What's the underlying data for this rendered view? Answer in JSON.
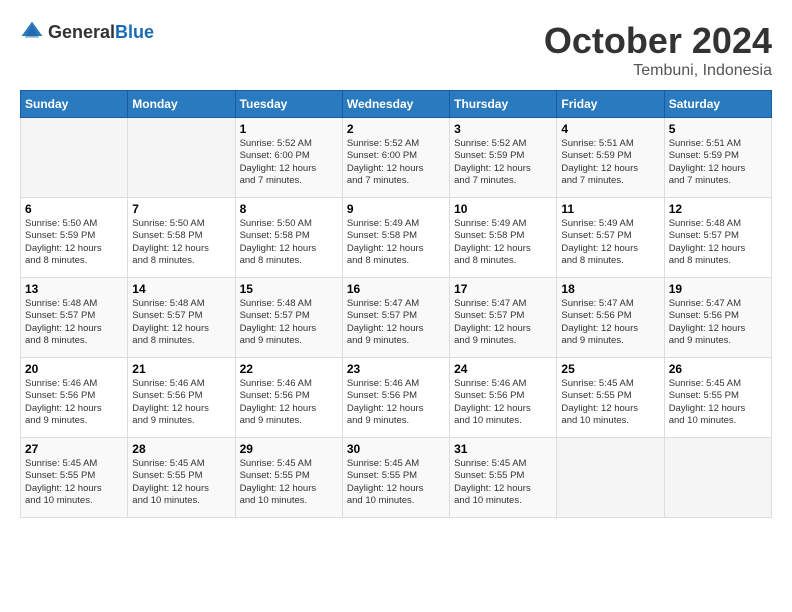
{
  "logo": {
    "general": "General",
    "blue": "Blue"
  },
  "title": "October 2024",
  "subtitle": "Tembuni, Indonesia",
  "headers": [
    "Sunday",
    "Monday",
    "Tuesday",
    "Wednesday",
    "Thursday",
    "Friday",
    "Saturday"
  ],
  "weeks": [
    [
      {
        "day": "",
        "info": ""
      },
      {
        "day": "",
        "info": ""
      },
      {
        "day": "1",
        "info": "Sunrise: 5:52 AM\nSunset: 6:00 PM\nDaylight: 12 hours\nand 7 minutes."
      },
      {
        "day": "2",
        "info": "Sunrise: 5:52 AM\nSunset: 6:00 PM\nDaylight: 12 hours\nand 7 minutes."
      },
      {
        "day": "3",
        "info": "Sunrise: 5:52 AM\nSunset: 5:59 PM\nDaylight: 12 hours\nand 7 minutes."
      },
      {
        "day": "4",
        "info": "Sunrise: 5:51 AM\nSunset: 5:59 PM\nDaylight: 12 hours\nand 7 minutes."
      },
      {
        "day": "5",
        "info": "Sunrise: 5:51 AM\nSunset: 5:59 PM\nDaylight: 12 hours\nand 7 minutes."
      }
    ],
    [
      {
        "day": "6",
        "info": "Sunrise: 5:50 AM\nSunset: 5:59 PM\nDaylight: 12 hours\nand 8 minutes."
      },
      {
        "day": "7",
        "info": "Sunrise: 5:50 AM\nSunset: 5:58 PM\nDaylight: 12 hours\nand 8 minutes."
      },
      {
        "day": "8",
        "info": "Sunrise: 5:50 AM\nSunset: 5:58 PM\nDaylight: 12 hours\nand 8 minutes."
      },
      {
        "day": "9",
        "info": "Sunrise: 5:49 AM\nSunset: 5:58 PM\nDaylight: 12 hours\nand 8 minutes."
      },
      {
        "day": "10",
        "info": "Sunrise: 5:49 AM\nSunset: 5:58 PM\nDaylight: 12 hours\nand 8 minutes."
      },
      {
        "day": "11",
        "info": "Sunrise: 5:49 AM\nSunset: 5:57 PM\nDaylight: 12 hours\nand 8 minutes."
      },
      {
        "day": "12",
        "info": "Sunrise: 5:48 AM\nSunset: 5:57 PM\nDaylight: 12 hours\nand 8 minutes."
      }
    ],
    [
      {
        "day": "13",
        "info": "Sunrise: 5:48 AM\nSunset: 5:57 PM\nDaylight: 12 hours\nand 8 minutes."
      },
      {
        "day": "14",
        "info": "Sunrise: 5:48 AM\nSunset: 5:57 PM\nDaylight: 12 hours\nand 8 minutes."
      },
      {
        "day": "15",
        "info": "Sunrise: 5:48 AM\nSunset: 5:57 PM\nDaylight: 12 hours\nand 9 minutes."
      },
      {
        "day": "16",
        "info": "Sunrise: 5:47 AM\nSunset: 5:57 PM\nDaylight: 12 hours\nand 9 minutes."
      },
      {
        "day": "17",
        "info": "Sunrise: 5:47 AM\nSunset: 5:57 PM\nDaylight: 12 hours\nand 9 minutes."
      },
      {
        "day": "18",
        "info": "Sunrise: 5:47 AM\nSunset: 5:56 PM\nDaylight: 12 hours\nand 9 minutes."
      },
      {
        "day": "19",
        "info": "Sunrise: 5:47 AM\nSunset: 5:56 PM\nDaylight: 12 hours\nand 9 minutes."
      }
    ],
    [
      {
        "day": "20",
        "info": "Sunrise: 5:46 AM\nSunset: 5:56 PM\nDaylight: 12 hours\nand 9 minutes."
      },
      {
        "day": "21",
        "info": "Sunrise: 5:46 AM\nSunset: 5:56 PM\nDaylight: 12 hours\nand 9 minutes."
      },
      {
        "day": "22",
        "info": "Sunrise: 5:46 AM\nSunset: 5:56 PM\nDaylight: 12 hours\nand 9 minutes."
      },
      {
        "day": "23",
        "info": "Sunrise: 5:46 AM\nSunset: 5:56 PM\nDaylight: 12 hours\nand 9 minutes."
      },
      {
        "day": "24",
        "info": "Sunrise: 5:46 AM\nSunset: 5:56 PM\nDaylight: 12 hours\nand 10 minutes."
      },
      {
        "day": "25",
        "info": "Sunrise: 5:45 AM\nSunset: 5:55 PM\nDaylight: 12 hours\nand 10 minutes."
      },
      {
        "day": "26",
        "info": "Sunrise: 5:45 AM\nSunset: 5:55 PM\nDaylight: 12 hours\nand 10 minutes."
      }
    ],
    [
      {
        "day": "27",
        "info": "Sunrise: 5:45 AM\nSunset: 5:55 PM\nDaylight: 12 hours\nand 10 minutes."
      },
      {
        "day": "28",
        "info": "Sunrise: 5:45 AM\nSunset: 5:55 PM\nDaylight: 12 hours\nand 10 minutes."
      },
      {
        "day": "29",
        "info": "Sunrise: 5:45 AM\nSunset: 5:55 PM\nDaylight: 12 hours\nand 10 minutes."
      },
      {
        "day": "30",
        "info": "Sunrise: 5:45 AM\nSunset: 5:55 PM\nDaylight: 12 hours\nand 10 minutes."
      },
      {
        "day": "31",
        "info": "Sunrise: 5:45 AM\nSunset: 5:55 PM\nDaylight: 12 hours\nand 10 minutes."
      },
      {
        "day": "",
        "info": ""
      },
      {
        "day": "",
        "info": ""
      }
    ]
  ]
}
